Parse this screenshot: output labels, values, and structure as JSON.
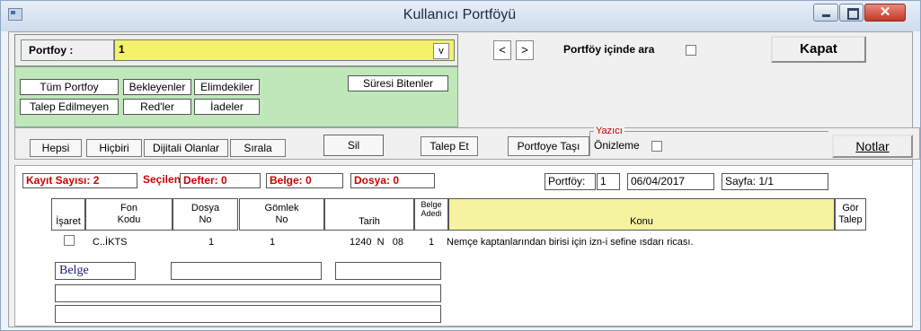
{
  "window": {
    "title": "Kullanıcı Portföyü"
  },
  "portfoy": {
    "label": "Portfoy :",
    "value": "1",
    "dropdown": "v"
  },
  "nav": {
    "prev": "<",
    "next": ">"
  },
  "search": {
    "label": "Portföy içinde ara"
  },
  "kapat": "Kapat",
  "filters": {
    "tum": "Tüm Portfoy",
    "bekleyenler": "Bekleyenler",
    "elimdekiler": "Elimdekiler",
    "suresi": "Süresi Bitenler",
    "talep_edilmeyen": "Talep Edilmeyen",
    "redler": "Red'ler",
    "iadeler": "İadeler"
  },
  "toolbar": {
    "hepsi": "Hepsi",
    "hicbiri": "Hiçbiri",
    "dijitali": "Dijitali Olanlar",
    "sirala": "Sırala",
    "sil": "Sil",
    "talep_et": "Talep Et",
    "portfoye": "Portfoye Taşı",
    "yazici": "Yazıcı",
    "onizleme": "Önizleme",
    "notlar": "Notlar"
  },
  "report": {
    "kayit": "Kayıt Sayısı: 2",
    "secilen": "Seçilen",
    "defter": "Defter: 0",
    "belge": "Belge: 0",
    "dosya": "Dosya: 0",
    "portfoy_label": "Portföy:",
    "portfoy_value": "1",
    "date": "06/04/2017",
    "sayfa": "Sayfa: 1/1"
  },
  "table": {
    "headers": {
      "isaret": "İşaret",
      "fon_top": "Fon",
      "fon_bottom": "Kodu",
      "dosya_top": "Dosya",
      "dosya_bottom": "No",
      "gomlek_top": "Gömlek",
      "gomlek_bottom": "No",
      "tarih": "Tarih",
      "belge_top": "Belge",
      "belge_bottom": "Adedi",
      "konu": "Konu",
      "gor_top": "Gör",
      "gor_bottom": "Talep"
    },
    "rows": [
      {
        "fon": "C..İKTS",
        "dosya": "1",
        "gomlek": "1",
        "tarih": "1240  N   08",
        "belge": "1",
        "konu": "Nemçe kaptanlarından birisi için izn-i sefine ısdarı ricası."
      }
    ]
  },
  "detail": {
    "belge_label": "Belge"
  }
}
